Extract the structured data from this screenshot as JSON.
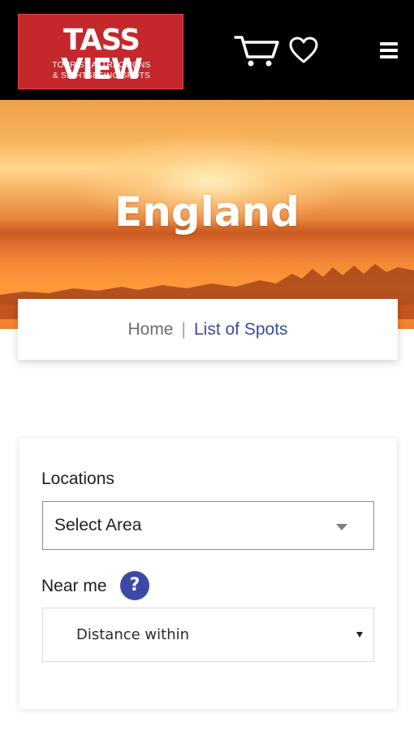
{
  "header": {
    "logo": {
      "title": "TASS VIEW",
      "subtitle_line1": "TOURIST ATTRACTIONS",
      "subtitle_line2": "& SIGHTSEEING SPOTS"
    },
    "icons": [
      "cart-icon",
      "heart-icon",
      "menu-icon"
    ]
  },
  "hero": {
    "title": "England"
  },
  "breadcrumb": {
    "home": "Home",
    "separator": "|",
    "current": "List of Spots"
  },
  "filters": {
    "locations_label": "Locations",
    "area_select_value": "Select Area",
    "near_me_label": "Near me",
    "help_symbol": "?",
    "distance_select_value": "Distance within"
  },
  "colors": {
    "header_bg": "#000000",
    "logo_red": "#c4282d",
    "accent_blue": "#3c4aa6",
    "breadcrumb_current": "#3b4aa0"
  }
}
